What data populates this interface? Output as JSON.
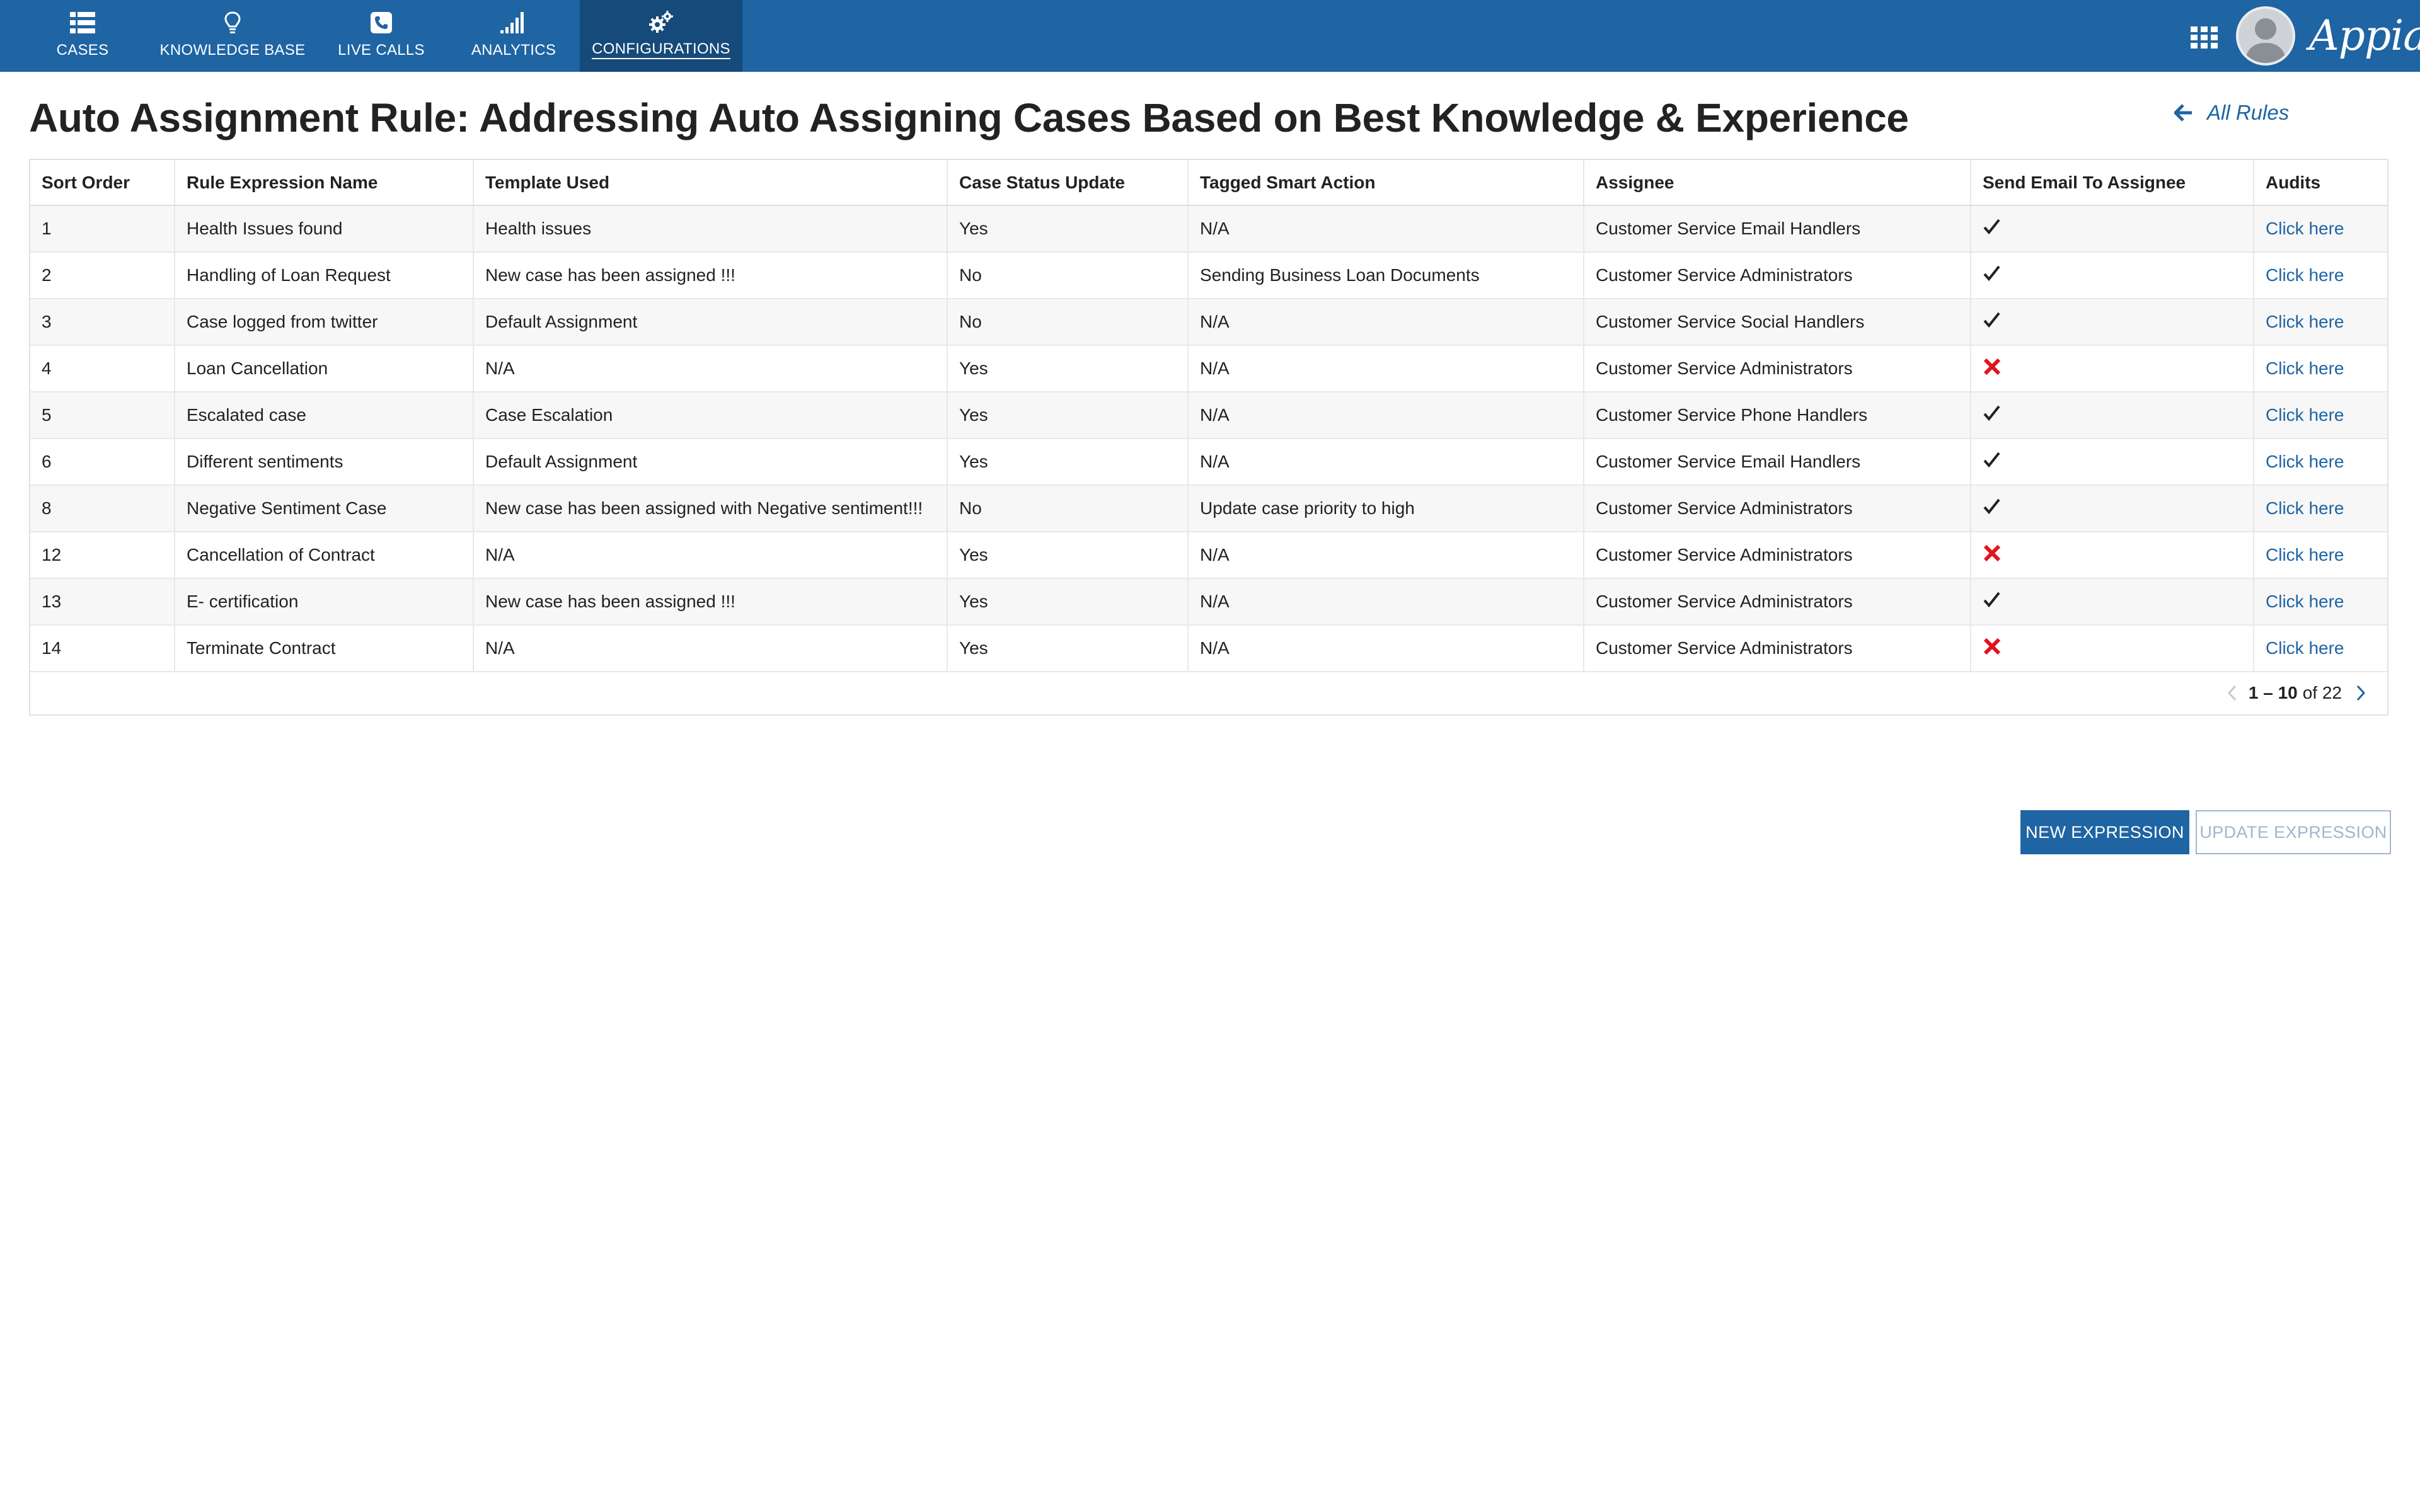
{
  "nav": {
    "tabs": [
      {
        "label": "CASES",
        "icon": "list-icon"
      },
      {
        "label": "KNOWLEDGE BASE",
        "icon": "lightbulb-icon"
      },
      {
        "label": "LIVE CALLS",
        "icon": "phone-icon"
      },
      {
        "label": "ANALYTICS",
        "icon": "signal-bars-icon"
      },
      {
        "label": "CONFIGURATIONS",
        "icon": "gears-icon",
        "active": true
      }
    ],
    "logo": "Appian",
    "accent_color": "#1f64a3",
    "active_tab_color": "#154a7a"
  },
  "page": {
    "title": "Auto Assignment Rule: Addressing Auto Assigning Cases Based on Best Knowledge & Experience",
    "back_link": "All Rules"
  },
  "table": {
    "columns": [
      "Sort Order",
      "Rule Expression Name",
      "Template Used",
      "Case Status Update",
      "Tagged Smart Action",
      "Assignee",
      "Send Email To Assignee",
      "Audits"
    ],
    "rows": [
      {
        "sort": "1",
        "name": "Health Issues found",
        "template": "Health issues",
        "status_update": "Yes",
        "smart_action": "N/A",
        "assignee": "Customer Service Email Handlers",
        "send_email": true,
        "audit": "Click here"
      },
      {
        "sort": "2",
        "name": "Handling of Loan Request",
        "template": "New case has been assigned !!!",
        "status_update": "No",
        "smart_action": "Sending Business Loan Documents",
        "assignee": "Customer Service Administrators",
        "send_email": true,
        "audit": "Click here"
      },
      {
        "sort": "3",
        "name": "Case logged from twitter",
        "template": "Default Assignment",
        "status_update": "No",
        "smart_action": "N/A",
        "assignee": "Customer Service Social Handlers",
        "send_email": true,
        "audit": "Click here"
      },
      {
        "sort": "4",
        "name": "Loan Cancellation",
        "template": "N/A",
        "status_update": "Yes",
        "smart_action": "N/A",
        "assignee": "Customer Service Administrators",
        "send_email": false,
        "audit": "Click here"
      },
      {
        "sort": "5",
        "name": "Escalated case",
        "template": "Case Escalation",
        "status_update": "Yes",
        "smart_action": "N/A",
        "assignee": "Customer Service Phone Handlers",
        "send_email": true,
        "audit": "Click here"
      },
      {
        "sort": "6",
        "name": "Different sentiments",
        "template": "Default Assignment",
        "status_update": "Yes",
        "smart_action": "N/A",
        "assignee": "Customer Service Email Handlers",
        "send_email": true,
        "audit": "Click here"
      },
      {
        "sort": "8",
        "name": "Negative Sentiment Case",
        "template": "New case has been assigned with Negative sentiment!!!",
        "status_update": "No",
        "smart_action": "Update case priority to high",
        "assignee": "Customer Service Administrators",
        "send_email": true,
        "audit": "Click here"
      },
      {
        "sort": "12",
        "name": "Cancellation of Contract",
        "template": "N/A",
        "status_update": "Yes",
        "smart_action": "N/A",
        "assignee": "Customer Service Administrators",
        "send_email": false,
        "audit": "Click here"
      },
      {
        "sort": "13",
        "name": "E- certification",
        "template": "New case has been assigned !!!",
        "status_update": "Yes",
        "smart_action": "N/A",
        "assignee": "Customer Service Administrators",
        "send_email": true,
        "audit": "Click here"
      },
      {
        "sort": "14",
        "name": "Terminate Contract",
        "template": "N/A",
        "status_update": "Yes",
        "smart_action": "N/A",
        "assignee": "Customer Service Administrators",
        "send_email": false,
        "audit": "Click here"
      }
    ],
    "pager": {
      "range": "1 – 10",
      "of_text": "of 22"
    },
    "check_color": "#222222",
    "cross_color": "#e0141e"
  },
  "buttons": {
    "new_expression": "NEW EXPRESSION",
    "update_expression": "UPDATE EXPRESSION"
  }
}
